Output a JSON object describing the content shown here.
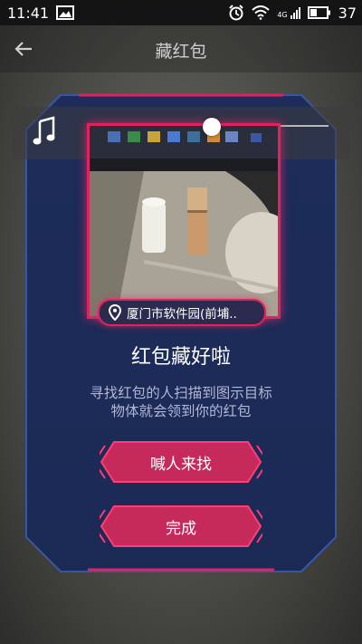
{
  "status_bar": {
    "time": "11:41",
    "network_label": "4G",
    "battery_level": "37",
    "icons": [
      "image-icon",
      "alarm-icon",
      "wifi-icon",
      "signal-icon",
      "battery-icon"
    ]
  },
  "header": {
    "title": "藏红包",
    "back_icon": "back-arrow-icon"
  },
  "music": {
    "icon": "music-note-icon"
  },
  "card": {
    "location": "厦门市软件园(前埔..",
    "heading": "红包藏好啦",
    "description_line1": "寻找红包的人扫描到图示目标",
    "description_line2": "物体就会领到你的红包",
    "call_button": "喊人来找",
    "done_button": "完成"
  },
  "colors": {
    "accent": "#e0235f",
    "card_bg": "#1f2e5b",
    "button_fill": "#c62a5a"
  }
}
